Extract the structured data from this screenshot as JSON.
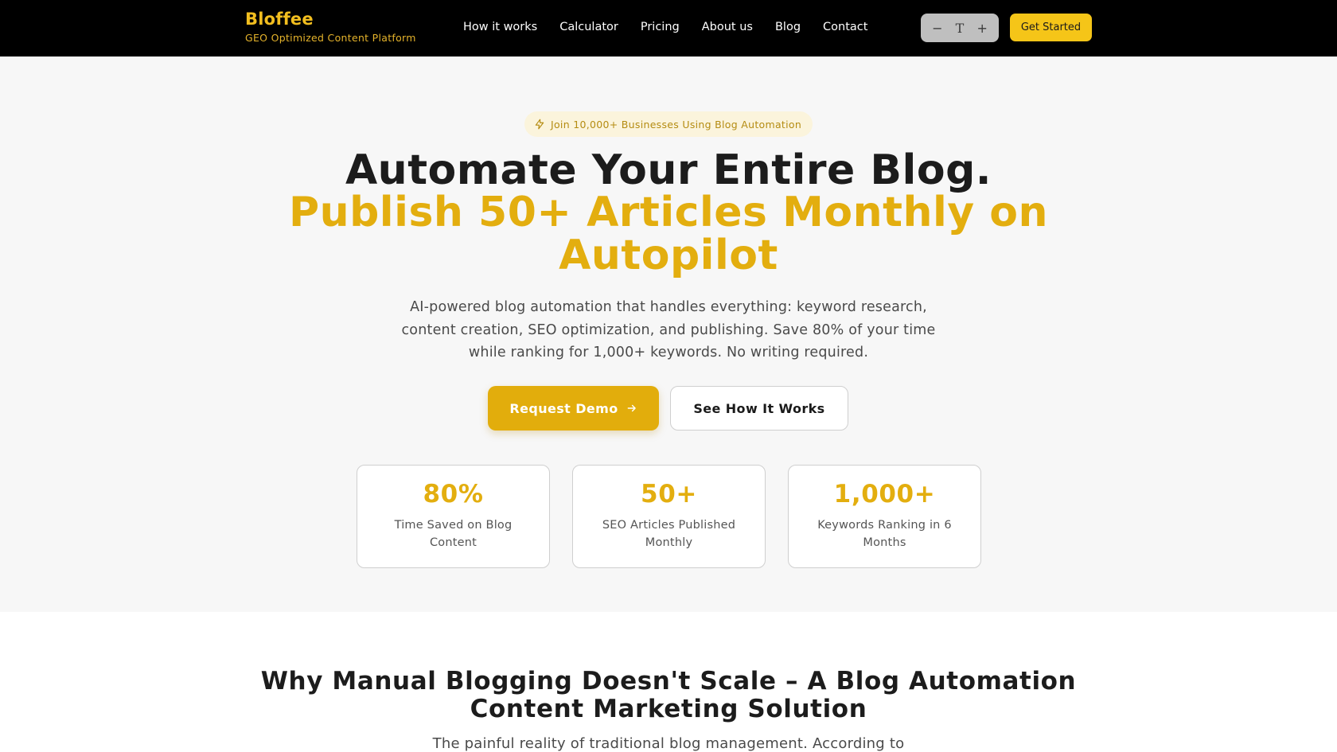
{
  "brand": {
    "name": "Bloffee",
    "tagline": "GEO Optimized Content Platform"
  },
  "nav": {
    "links": [
      "How it works",
      "Calculator",
      "Pricing",
      "About us",
      "Blog",
      "Contact"
    ],
    "font_controls": {
      "decrease": "−",
      "type": "T",
      "increase": "+"
    },
    "cta_label": "Get Started"
  },
  "hero": {
    "badge": "Join 10,000+ Businesses Using Blog Automation",
    "title_line1": "Automate Your Entire Blog.",
    "title_line2": "Publish 50+ Articles Monthly on",
    "title_line3": "Autopilot",
    "description": "AI-powered blog automation that handles everything: keyword research, content creation, SEO optimization, and publishing. Save 80% of your time while ranking for 1,000+ keywords. No writing required.",
    "primary_button": "Request Demo",
    "secondary_button": "See How It Works",
    "stats": [
      {
        "value": "80%",
        "label": "Time Saved on Blog Content"
      },
      {
        "value": "50+",
        "label": "SEO Articles Published Monthly"
      },
      {
        "value": "1,000+",
        "label": "Keywords Ranking in 6 Months"
      }
    ]
  },
  "section2": {
    "title_line1": "Why Manual Blogging Doesn't Scale – A Blog Automation",
    "title_line2": "Content Marketing Solution",
    "intro": "The painful reality of traditional blog management. According to"
  },
  "colors": {
    "accent": "#e3ae0f",
    "nav_bg": "#000000",
    "cta_yellow": "#f5c518"
  }
}
